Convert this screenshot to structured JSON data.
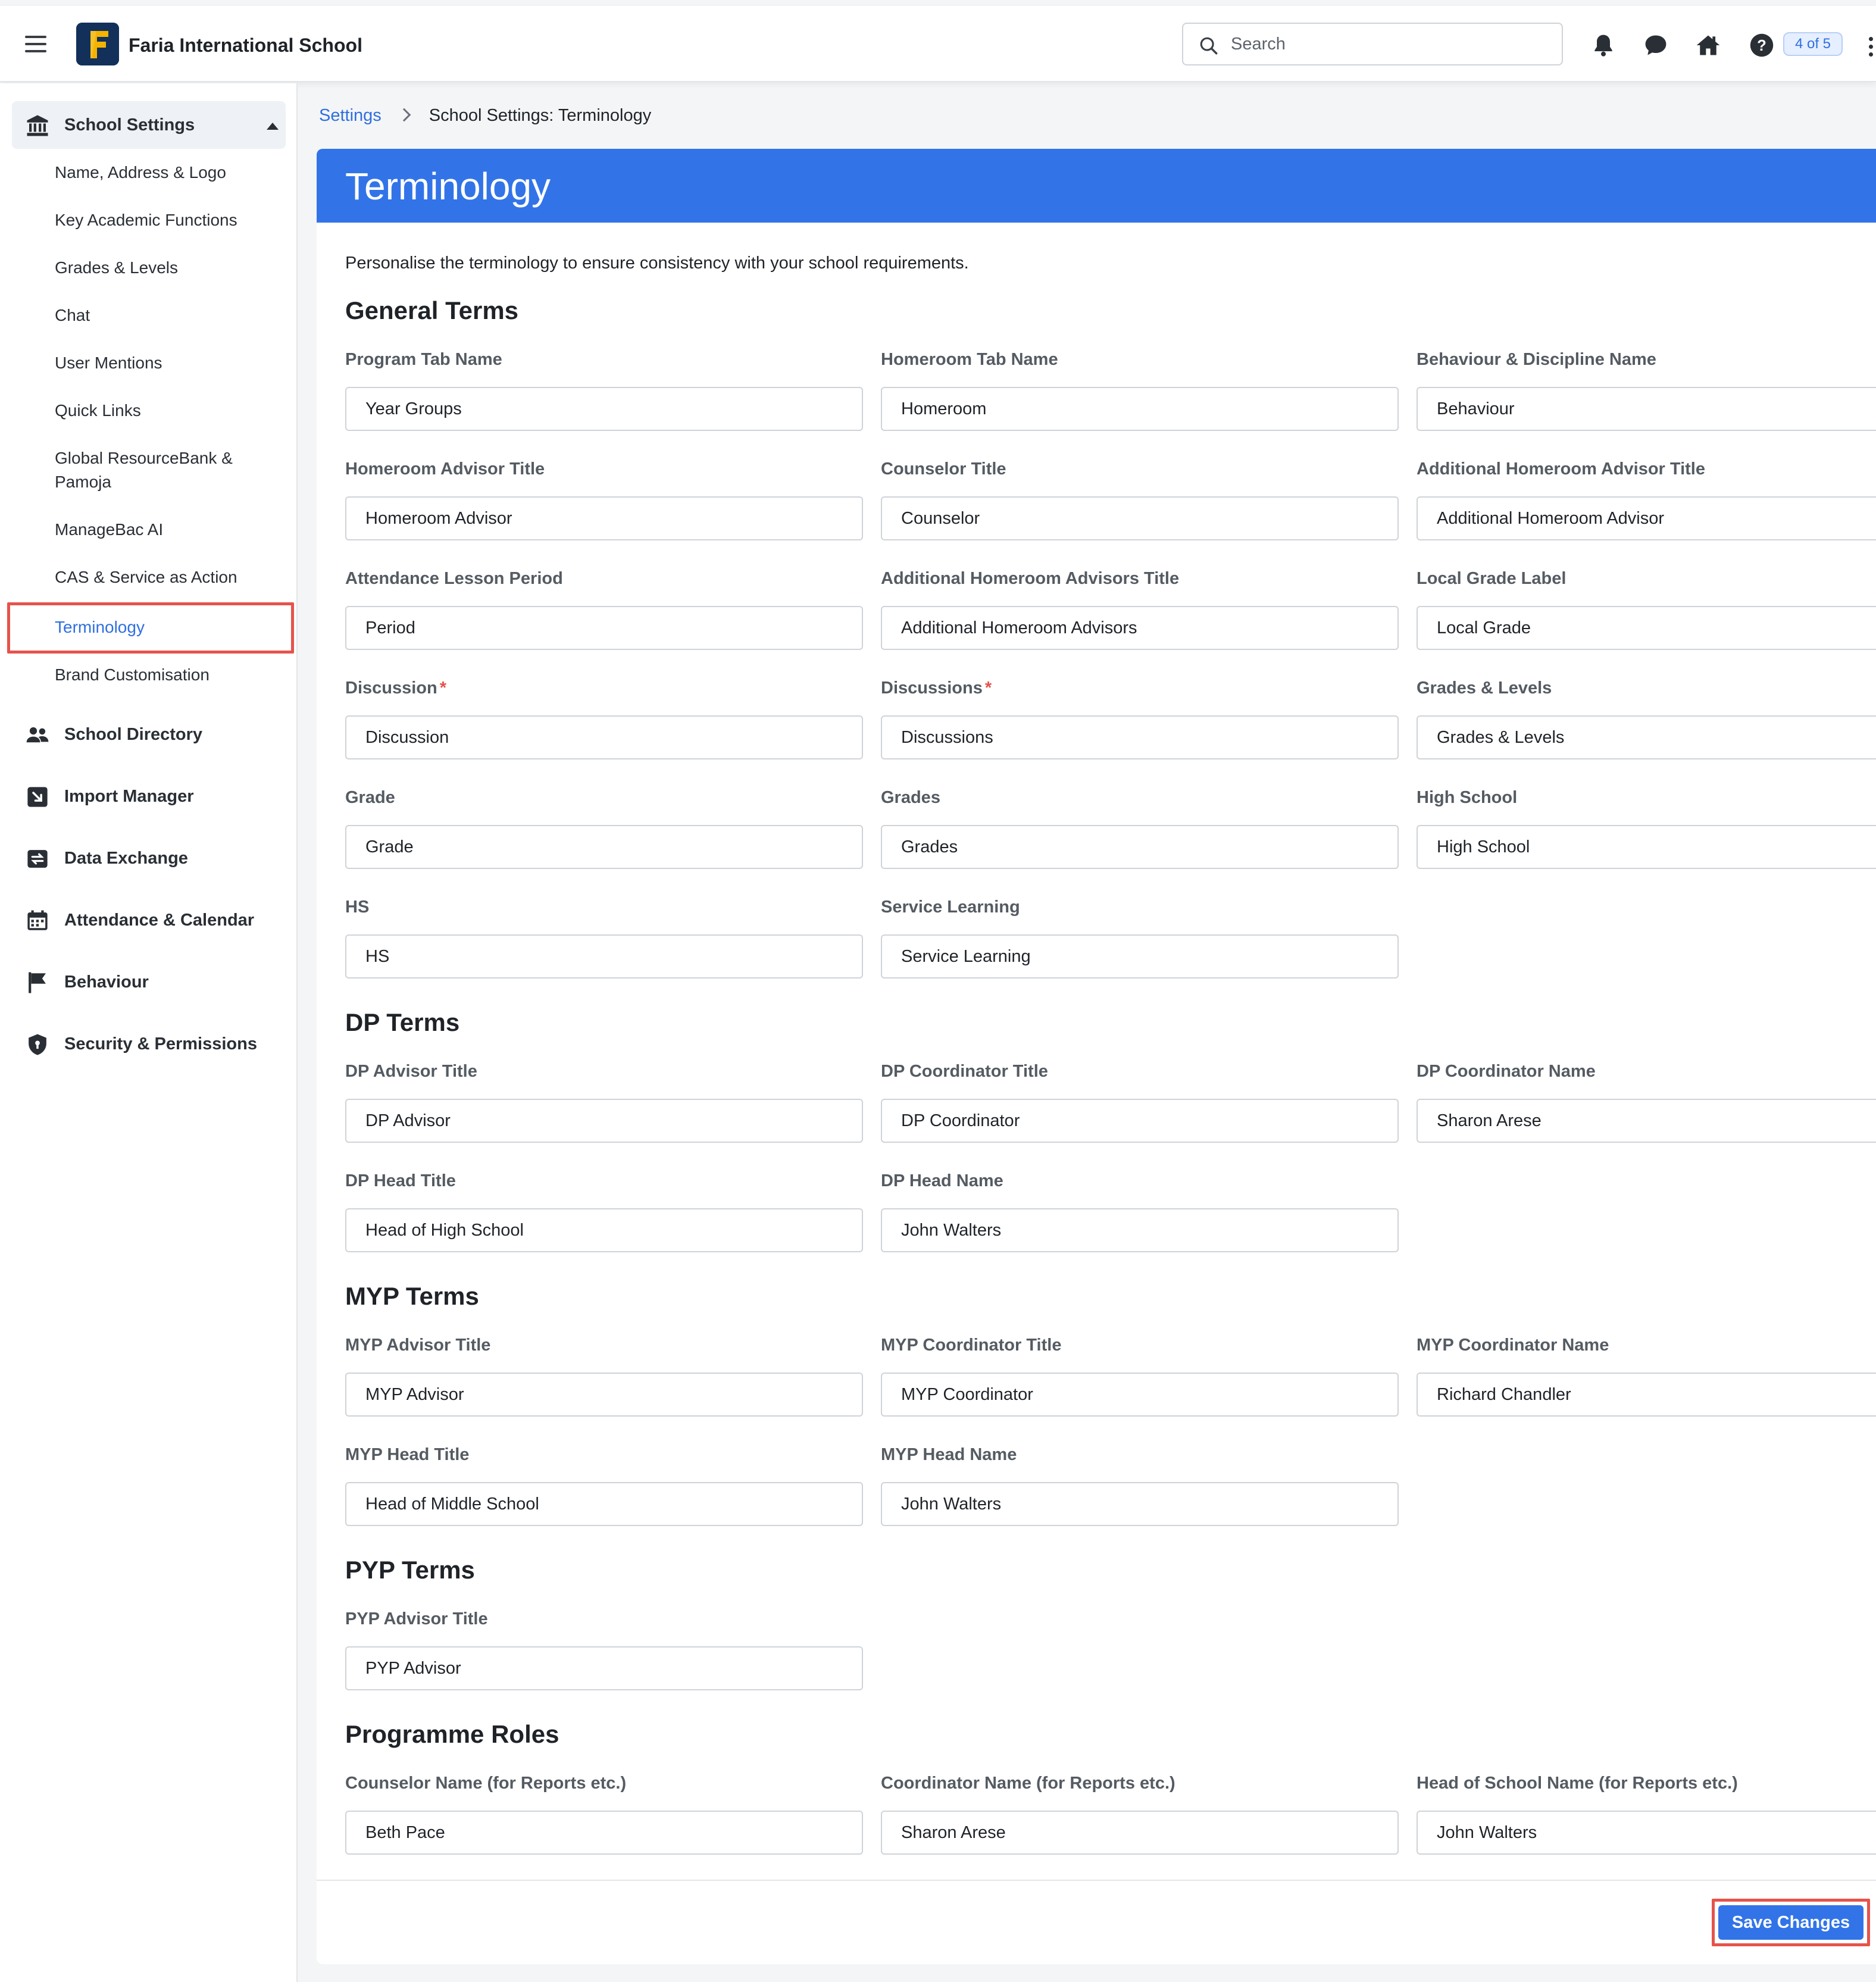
{
  "header": {
    "school_name": "Faria International School",
    "search_placeholder": "Search",
    "badge": "4 of 5",
    "icons": [
      "menu-icon",
      "school-logo",
      "search-icon",
      "bell-icon",
      "chat-icon",
      "home-icon",
      "help-icon",
      "more-vertical-icon"
    ]
  },
  "sidebar": {
    "section": "School Settings",
    "sub_items": [
      "Name, Address & Logo",
      "Key Academic Functions",
      "Grades & Levels",
      "Chat",
      "User Mentions",
      "Quick Links",
      "Global ResourceBank &",
      "Pamoja",
      "ManageBac AI",
      "CAS & Service as Action",
      "Terminology",
      "Brand Customisation"
    ],
    "nav_items": [
      "School Directory",
      "Import Manager",
      "Data Exchange",
      "Attendance & Calendar",
      "Behaviour",
      "Security & Permissions"
    ]
  },
  "breadcrumb": {
    "link": "Settings",
    "current": "School Settings: Terminology"
  },
  "page": {
    "title": "Terminology",
    "intro": "Personalise the terminology to ensure consistency with your school requirements.",
    "save_label": "Save Changes"
  },
  "sections": {
    "general": {
      "title": "General Terms",
      "fields": [
        {
          "label": "Program Tab Name",
          "value": "Year Groups"
        },
        {
          "label": "Homeroom Tab Name",
          "value": "Homeroom"
        },
        {
          "label": "Behaviour & Discipline Name",
          "value": "Behaviour"
        },
        {
          "label": "Homeroom Advisor Title",
          "value": "Homeroom Advisor"
        },
        {
          "label": "Counselor Title",
          "value": "Counselor"
        },
        {
          "label": "Additional Homeroom Advisor Title",
          "value": "Additional Homeroom Advisor"
        },
        {
          "label": "Attendance Lesson Period",
          "value": "Period"
        },
        {
          "label": "Additional Homeroom Advisors Title",
          "value": "Additional Homeroom Advisors"
        },
        {
          "label": "Local Grade Label",
          "value": "Local Grade"
        },
        {
          "label": "Discussion",
          "value": "Discussion",
          "required": "*"
        },
        {
          "label": "Discussions",
          "value": "Discussions",
          "required": "*"
        },
        {
          "label": "Grades & Levels",
          "value": "Grades & Levels"
        },
        {
          "label": "Grade",
          "value": "Grade"
        },
        {
          "label": "Grades",
          "value": "Grades"
        },
        {
          "label": "High School",
          "value": "High School"
        },
        {
          "label": "HS",
          "value": "HS"
        },
        {
          "label": "Service Learning",
          "value": "Service Learning"
        }
      ]
    },
    "dp": {
      "title": "DP Terms",
      "fields": [
        {
          "label": "DP Advisor Title",
          "value": "DP Advisor"
        },
        {
          "label": "DP Coordinator Title",
          "value": "DP Coordinator"
        },
        {
          "label": "DP Coordinator Name",
          "value": "Sharon Arese"
        },
        {
          "label": "DP Head Title",
          "value": "Head of High School"
        },
        {
          "label": "DP Head Name",
          "value": "John Walters"
        }
      ]
    },
    "myp": {
      "title": "MYP Terms",
      "fields": [
        {
          "label": "MYP Advisor Title",
          "value": "MYP Advisor"
        },
        {
          "label": "MYP Coordinator Title",
          "value": "MYP Coordinator"
        },
        {
          "label": "MYP Coordinator Name",
          "value": "Richard Chandler"
        },
        {
          "label": "MYP Head Title",
          "value": "Head of Middle School"
        },
        {
          "label": "MYP Head Name",
          "value": "John Walters"
        }
      ]
    },
    "pyp": {
      "title": "PYP Terms",
      "fields": [
        {
          "label": "PYP Advisor Title",
          "value": "PYP Advisor"
        }
      ]
    },
    "roles": {
      "title": "Programme Roles",
      "fields": [
        {
          "label": "Counselor Name (for Reports etc.)",
          "value": "Beth Pace"
        },
        {
          "label": "Coordinator Name (for Reports etc.)",
          "value": "Sharon Arese"
        },
        {
          "label": "Head of School Name (for Reports etc.)",
          "value": "John Walters"
        }
      ]
    }
  },
  "colors": {
    "accent": "#3274e8",
    "highlight": "#e5534b",
    "link": "#2f6fe0"
  }
}
